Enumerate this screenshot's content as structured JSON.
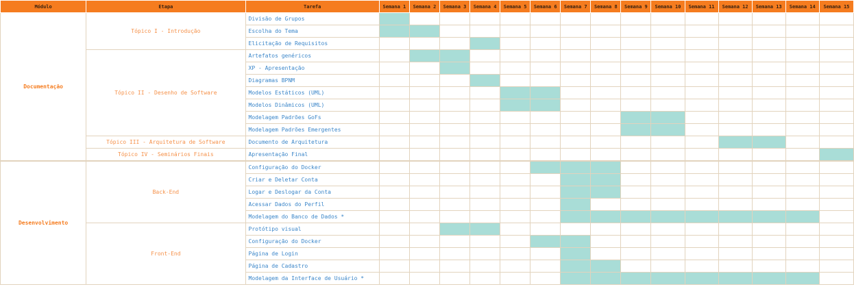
{
  "headers": {
    "modulo": "Módulo",
    "etapa": "Etapa",
    "tarefa": "Tarefa",
    "weeks": [
      "Semana 1",
      "Semana 2",
      "Semana 3",
      "Semana 4",
      "Semana 5",
      "Semana 6",
      "Semana 7",
      "Semana 8",
      "Semana 9",
      "Semana 10",
      "Semana 11",
      "Semana 12",
      "Semana 13",
      "Semana 14",
      "Semana 15"
    ]
  },
  "colors": {
    "header": "#f57c1f",
    "bar": "#a9ddd7",
    "module_text": "#f57c1f",
    "stage_text": "#f5914a",
    "task_text": "#3b86c9"
  },
  "modules": [
    {
      "name": "Documentação",
      "stages": [
        {
          "name": "Tópico I - Introdução",
          "tasks": [
            {
              "name": "Divisão de Grupos",
              "weeks": [
                1
              ]
            },
            {
              "name": "Escolha do Tema",
              "weeks": [
                1,
                2
              ]
            },
            {
              "name": "Elicitação de Requisitos",
              "weeks": [
                4
              ]
            }
          ]
        },
        {
          "name": "Tópico II - Desenho de Software",
          "tasks": [
            {
              "name": "Artefatos genéricos",
              "weeks": [
                2,
                3
              ]
            },
            {
              "name": "XP - Apresentação",
              "weeks": [
                3
              ]
            },
            {
              "name": "Diagramas BPNM",
              "weeks": [
                4
              ]
            },
            {
              "name": "Modelos Estáticos (UML)",
              "weeks": [
                5,
                6
              ]
            },
            {
              "name": "Modelos Dinâmicos (UML)",
              "weeks": [
                5,
                6
              ]
            },
            {
              "name": "Modelagem Padrões GoFs",
              "weeks": [
                9,
                10
              ]
            },
            {
              "name": "Modelagem Padrões Emergentes",
              "weeks": [
                9,
                10
              ]
            }
          ]
        },
        {
          "name": "Tópico III - Arquitetura de Software",
          "tasks": [
            {
              "name": "Documento de Arquitetura",
              "weeks": [
                12,
                13
              ]
            }
          ]
        },
        {
          "name": "Tópico IV - Seminários Finais",
          "tasks": [
            {
              "name": "Apresentação Final",
              "weeks": [
                15
              ]
            }
          ]
        }
      ]
    },
    {
      "name": "Desenvolvimento",
      "stages": [
        {
          "name": "Back-End",
          "tasks": [
            {
              "name": "Configuração do Docker",
              "weeks": [
                6,
                7,
                8
              ]
            },
            {
              "name": "Criar e Deletar Conta",
              "weeks": [
                7,
                8
              ]
            },
            {
              "name": "Logar e Deslogar da Conta",
              "weeks": [
                7,
                8
              ]
            },
            {
              "name": "Acessar Dados do Perfil",
              "weeks": [
                7
              ]
            },
            {
              "name": "Modelagem do Banco de Dados *",
              "weeks": [
                7,
                8,
                9,
                10,
                11,
                12,
                13,
                14
              ]
            }
          ]
        },
        {
          "name": "Front-End",
          "tasks": [
            {
              "name": "Protótipo visual",
              "weeks": [
                3,
                4
              ]
            },
            {
              "name": "Configuração do Docker",
              "weeks": [
                6,
                7
              ]
            },
            {
              "name": "Página de Login",
              "weeks": [
                7
              ]
            },
            {
              "name": "Página de Cadastro",
              "weeks": [
                7,
                8
              ]
            },
            {
              "name": "Modelagem da Interface de Usuário *",
              "weeks": [
                7,
                8,
                9,
                10,
                11,
                12,
                13,
                14
              ]
            }
          ]
        }
      ]
    }
  ]
}
